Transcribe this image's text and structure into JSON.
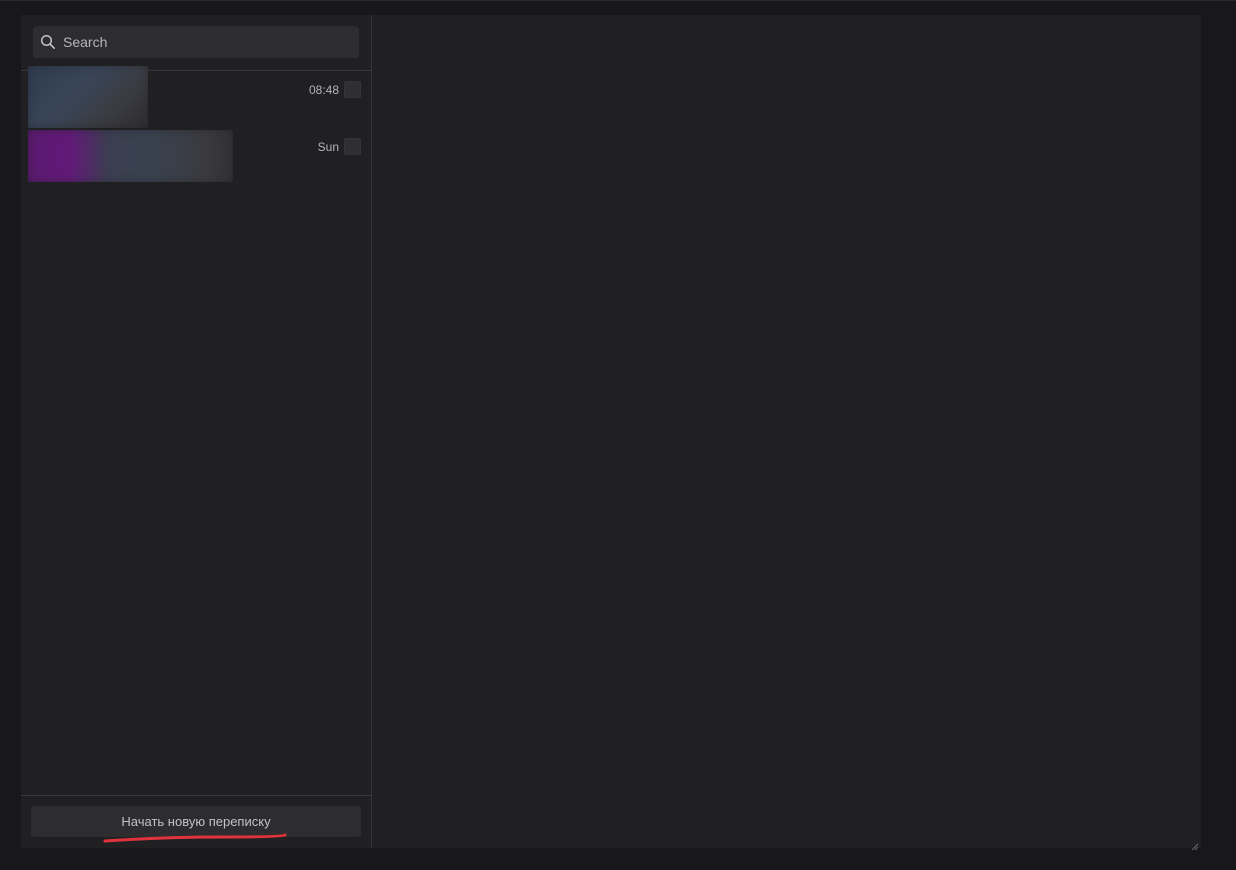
{
  "search": {
    "placeholder": "Search",
    "icon": "search-icon"
  },
  "chats": [
    {
      "time": "08:48"
    },
    {
      "time": "Sun"
    }
  ],
  "footer": {
    "new_chat_label": "Начать новую переписку"
  },
  "colors": {
    "background": "#18181a",
    "panel": "#202022",
    "input_bg": "#2d2d30",
    "text": "#c3c3c6",
    "underline_annotation": "#e0333b"
  }
}
